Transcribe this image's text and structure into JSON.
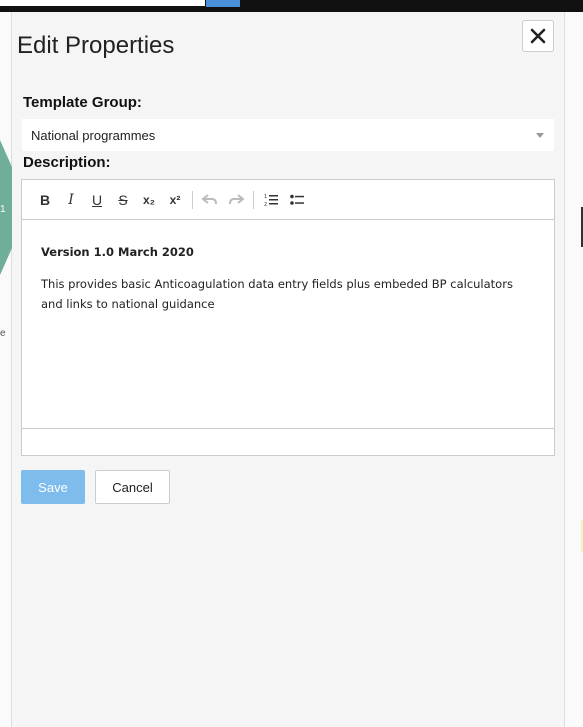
{
  "dialog": {
    "title": "Edit Properties"
  },
  "template_group": {
    "label": "Template Group:",
    "selected": "National programmes"
  },
  "description": {
    "label": "Description:",
    "content_heading": "Version 1.0 March 2020",
    "content_body": "This provides basic Anticoagulation data entry fields plus embeded BP calculators and links to national guidance"
  },
  "toolbar": {
    "bold": "B",
    "italic": "I",
    "underline": "U",
    "strike": "S",
    "subscript": "x₂",
    "superscript": "x²"
  },
  "buttons": {
    "save": "Save",
    "cancel": "Cancel"
  },
  "background": {
    "left_marker": "1",
    "left_text": "e"
  },
  "colors": {
    "accent": "#7dbcec",
    "hex": "#6fae99"
  }
}
